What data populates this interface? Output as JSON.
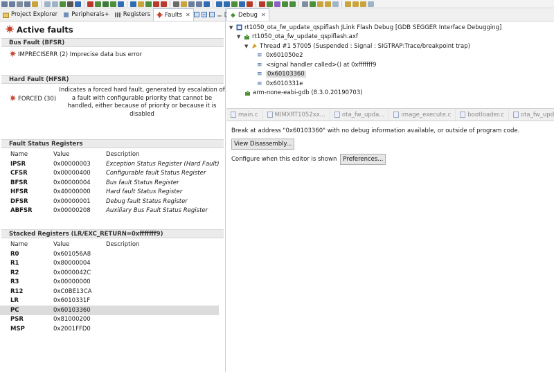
{
  "toolbar": {
    "icons": [
      "#6a7fa0",
      "#6a7fa0",
      "#7f8f9f",
      "#6a7fa0",
      "#c9a43b",
      "#9fb3c8",
      "#9fb3c8",
      "#4c8f3a",
      "#555555",
      "#2e6db4",
      "#b83a2a",
      "#4c8f3a",
      "#3a7a3a",
      "#4c8f3a",
      "#2e6db4",
      "#2e6db4",
      "#c9a43b",
      "#4c8f3a",
      "#b83a2a",
      "#b83a2a",
      "#6a6a6a",
      "#c9a43b",
      "#6a7fa0",
      "#6a7fa0",
      "#2e6db4",
      "#2e6db4",
      "#2e6db4",
      "#4c8f3a",
      "#2e6db4",
      "#b83a2a",
      "#b83a2a",
      "#4c8f3a",
      "#8f5fc4",
      "#4c8f3a",
      "#4c8f3a",
      "#7f8f9f",
      "#4c8f3a",
      "#c9a43b",
      "#c9a43b",
      "#9fb3c8",
      "#c9a43b",
      "#c9a43b",
      "#c9a43b",
      "#9fb3c8"
    ]
  },
  "left": {
    "tabs": [
      {
        "label": "Project Explorer",
        "icon": "project-explorer-icon"
      },
      {
        "label": "Peripherals+",
        "icon": "peripherals-icon"
      },
      {
        "label": "Registers",
        "icon": "registers-icon"
      },
      {
        "label": "Faults",
        "icon": "faults-icon",
        "close": "✕"
      }
    ],
    "active_title": "Active faults",
    "bus_fault": {
      "header": "Bus Fault (BFSR)",
      "item": "IMPRECISERR (2)  Imprecise data bus error"
    },
    "hard_fault": {
      "header": "Hard Fault (HFSR)",
      "label": "FORCED (30)",
      "description": "Indicates a forced hard fault, generated by escalation of a fault with configurable priority that cannot be handled, either because of priority or because it is disabled"
    },
    "fault_status": {
      "header": "Fault Status Registers",
      "columns": [
        "Name",
        "Value",
        "Description"
      ],
      "rows": [
        {
          "name": "IPSR",
          "value": "0x00000003",
          "desc": "Exception Status Register (Hard Fault)"
        },
        {
          "name": "CFSR",
          "value": "0x00000400",
          "desc": "Configurable fault Status Register"
        },
        {
          "name": "BFSR",
          "value": "0x00000004",
          "desc": "Bus fault Status Register"
        },
        {
          "name": "HFSR",
          "value": "0x40000000",
          "desc": "Hard fault Status Register"
        },
        {
          "name": "DFSR",
          "value": "0x00000001",
          "desc": "Debug fault Status Register"
        },
        {
          "name": "ABFSR",
          "value": "0x00000208",
          "desc": "Auxiliary Bus Fault Status Register"
        }
      ]
    },
    "stacked": {
      "header": "Stacked Registers (LR/EXC_RETURN=0xfffffff9)",
      "columns": [
        "Name",
        "Value",
        "Description"
      ],
      "rows": [
        {
          "name": "R0",
          "value": "0x601056A8",
          "desc": ""
        },
        {
          "name": "R1",
          "value": "0x80000004",
          "desc": ""
        },
        {
          "name": "R2",
          "value": "0x0000042C",
          "desc": ""
        },
        {
          "name": "R3",
          "value": "0x00000000",
          "desc": ""
        },
        {
          "name": "R12",
          "value": "0xC0BE13CA",
          "desc": ""
        },
        {
          "name": "LR",
          "value": "0x6010331F",
          "desc": ""
        },
        {
          "name": "PC",
          "value": "0x60103360",
          "desc": ""
        },
        {
          "name": "PSR",
          "value": "0x81000200",
          "desc": ""
        },
        {
          "name": "MSP",
          "value": "0x2001FFD0",
          "desc": ""
        }
      ],
      "selected_row": 6
    }
  },
  "right": {
    "tab": {
      "label": "Debug",
      "close": "✕"
    },
    "tree": {
      "launch": "rt1050_ota_fw_update_qspiflash JLink Flash Debug [GDB SEGGER Interface Debugging]",
      "elf": "rt1050_ota_fw_update_qspiflash.axf",
      "thread": "Thread #1 57005 (Suspended : Signal : SIGTRAP:Trace/breakpoint trap)",
      "frames": [
        "0x601050e2",
        "<signal handler called>() at 0xfffffff9",
        "0x60103360",
        "0x6010331e"
      ],
      "selected_frame": 2,
      "gdb": "arm-none-eabi-gdb (8.3.0.20190703)"
    },
    "editor_tabs": [
      "main.c",
      "MIMXRT1052xx...",
      "ota_fw_upda...",
      "image_execute.c",
      "bootloader.c",
      "ota_fw_upda..."
    ],
    "editor": {
      "message": "Break at address \"0x60103360\" with no debug information available, or outside of program code.",
      "view_disassembly": "View Disassembly...",
      "configure_text": "Configure when this editor is shown",
      "preferences": "Preferences..."
    }
  }
}
